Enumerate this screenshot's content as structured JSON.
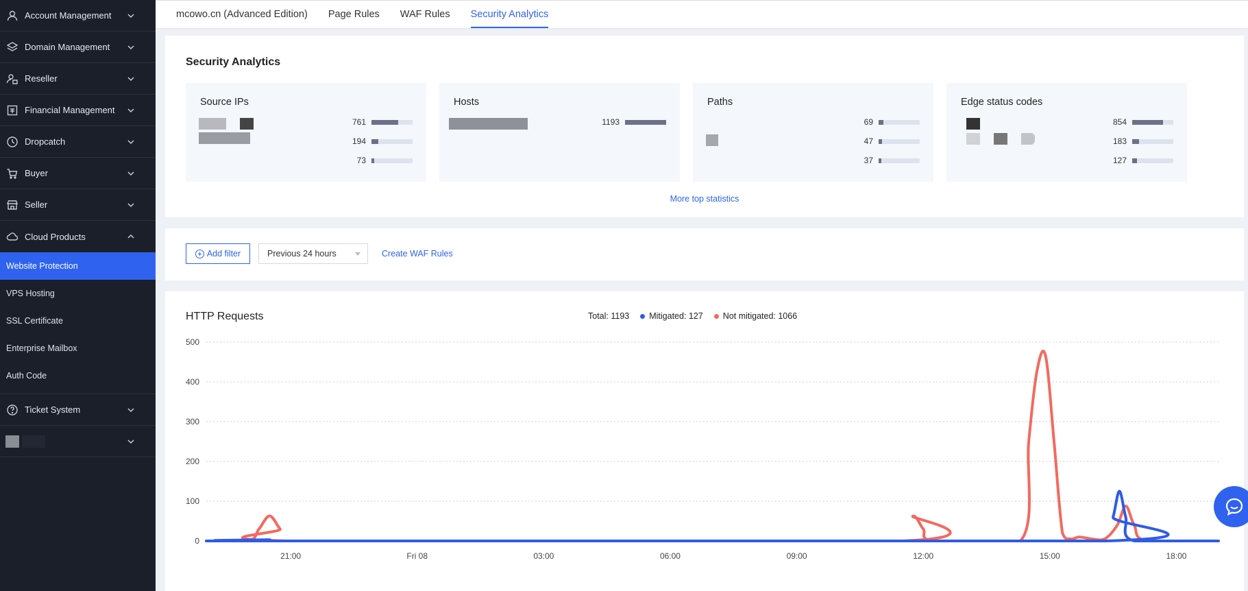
{
  "sidebar": {
    "items": [
      {
        "label": "Account Management",
        "icon": "user-icon"
      },
      {
        "label": "Domain Management",
        "icon": "layers-icon"
      },
      {
        "label": "Reseller",
        "icon": "reseller-icon"
      },
      {
        "label": "Financial Management",
        "icon": "finance-icon"
      },
      {
        "label": "Dropcatch",
        "icon": "clock-icon"
      },
      {
        "label": "Buyer",
        "icon": "cart-icon"
      },
      {
        "label": "Seller",
        "icon": "store-icon"
      },
      {
        "label": "Cloud Products",
        "icon": "cloud-icon"
      }
    ],
    "cloud_sub": [
      {
        "label": "Website Protection",
        "active": true
      },
      {
        "label": "VPS Hosting"
      },
      {
        "label": "SSL Certificate"
      },
      {
        "label": "Enterprise Mailbox"
      },
      {
        "label": "Auth Code"
      }
    ],
    "ticket": {
      "label": "Ticket System",
      "icon": "help-icon"
    }
  },
  "tabs": [
    {
      "label": "mcowo.cn (Advanced Edition)"
    },
    {
      "label": "Page Rules"
    },
    {
      "label": "WAF Rules"
    },
    {
      "label": "Security Analytics",
      "active": true
    }
  ],
  "security": {
    "title": "Security Analytics",
    "cards": [
      {
        "title": "Source IPs",
        "rows": [
          {
            "value": "761",
            "fill": 0.65
          },
          {
            "value": "194",
            "fill": 0.17
          },
          {
            "value": "73",
            "fill": 0.06
          }
        ]
      },
      {
        "title": "Hosts",
        "rows": [
          {
            "value": "1193",
            "fill": 1.0
          }
        ]
      },
      {
        "title": "Paths",
        "rows": [
          {
            "value": "69",
            "fill": 0.12
          },
          {
            "value": "47",
            "fill": 0.08
          },
          {
            "value": "37",
            "fill": 0.07
          }
        ]
      },
      {
        "title": "Edge status codes",
        "rows": [
          {
            "value": "854",
            "fill": 0.75
          },
          {
            "value": "183",
            "fill": 0.16
          },
          {
            "value": "127",
            "fill": 0.11
          }
        ]
      }
    ],
    "more_link": "More top statistics"
  },
  "filter": {
    "add_label": "Add filter",
    "range": "Previous 24 hours",
    "create_link": "Create WAF Rules"
  },
  "http": {
    "title": "HTTP Requests",
    "total": "Total: 1193",
    "mitigated": "Mitigated: 127",
    "not_mitigated": "Not mitigated: 1066"
  },
  "chart_data": {
    "type": "line",
    "xlabel": "",
    "ylabel": "",
    "ylim": [
      0,
      500
    ],
    "yticks": [
      0,
      100,
      200,
      300,
      400,
      500
    ],
    "xlim": [
      19.0,
      19.0
    ],
    "xtick_labels": [
      "21:00",
      "Fri 08",
      "03:00",
      "06:00",
      "09:00",
      "12:00",
      "15:00",
      "18:00"
    ],
    "xtick_hours": [
      21,
      24,
      27,
      30,
      33,
      36,
      39,
      42
    ],
    "x_range_hours": [
      19.0,
      43.0
    ],
    "grid": true,
    "series": [
      {
        "name": "Not mitigated",
        "color": "#f26a5f",
        "x": [
          19.0,
          20.0,
          20.25,
          20.5,
          20.75,
          21.0,
          35.5,
          35.75,
          36.0,
          36.25,
          38.3,
          38.5,
          38.7,
          38.9,
          39.1,
          39.3,
          39.5,
          39.7,
          40.0,
          40.3,
          40.6,
          40.8,
          41.0,
          41.3,
          43.0
        ],
        "y": [
          0,
          0,
          30,
          63,
          30,
          0,
          0,
          62,
          30,
          0,
          0,
          250,
          430,
          465,
          250,
          20,
          5,
          10,
          5,
          5,
          40,
          88,
          40,
          0,
          0
        ]
      },
      {
        "name": "Mitigated",
        "color": "#2f5be6",
        "x": [
          19.0,
          20.4,
          20.5,
          20.7,
          40.3,
          40.5,
          40.65,
          40.8,
          41.0,
          43.0
        ],
        "y": [
          0,
          0,
          3,
          0,
          0,
          60,
          125,
          60,
          0,
          0
        ]
      }
    ]
  },
  "colors": {
    "accent": "#2f63ef",
    "sidebar_bg": "#1b1f2a",
    "mitigated": "#2f5be6",
    "not_mitigated": "#f26a5f"
  }
}
